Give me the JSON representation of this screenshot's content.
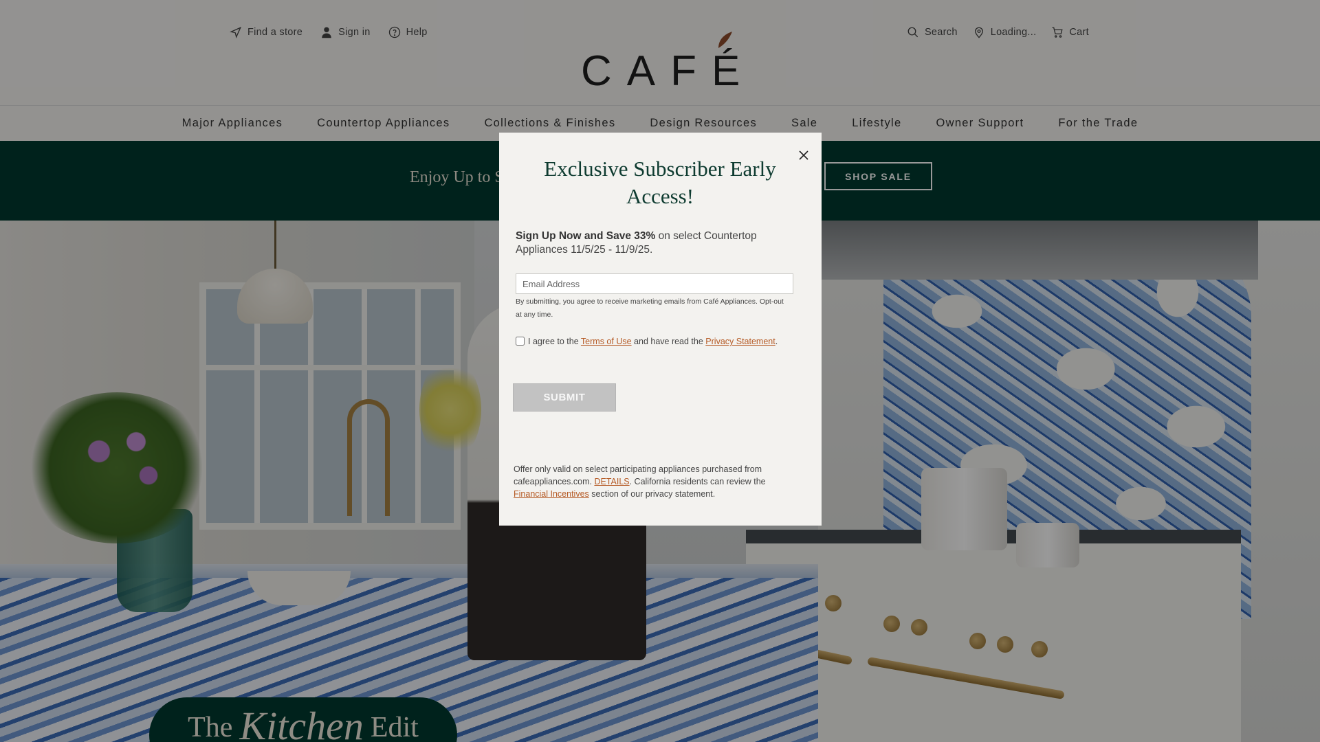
{
  "header": {
    "util_left": [
      {
        "label": "Find a store",
        "icon": "navigation-arrow-icon"
      },
      {
        "label": "Sign in",
        "icon": "user-icon"
      },
      {
        "label": "Help",
        "icon": "help-circle-icon"
      }
    ],
    "util_right": [
      {
        "label": "Search",
        "icon": "search-icon"
      },
      {
        "label": "Loading...",
        "icon": "location-pin-icon"
      },
      {
        "label": "Cart",
        "icon": "cart-icon"
      }
    ],
    "logo_text": "CAFÉ"
  },
  "nav": {
    "items": [
      "Major Appliances",
      "Countertop Appliances",
      "Collections & Finishes",
      "Design Resources",
      "Sale",
      "Lifestyle",
      "Owner Support",
      "For the Trade"
    ]
  },
  "promo": {
    "text": "Enjoy Up to S",
    "button": "SHOP SALE",
    "bg_color": "#00392f"
  },
  "hero": {
    "badge_the": "The",
    "badge_kitchen": "Kitchen",
    "badge_edit": "Edit"
  },
  "modal": {
    "title": "Exclusive Subscriber Early Access!",
    "lead_bold": "Sign Up Now and Save 33%",
    "lead_rest": " on select Countertop Appliances 11/5/25 - 11/9/25.",
    "email_placeholder": "Email Address",
    "consent": "By submitting, you agree to receive marketing emails from Café Appliances. Opt-out at any time.",
    "agree_prefix": "I agree to the ",
    "terms_link": "Terms of Use",
    "agree_middle": " and have read the ",
    "privacy_link": "Privacy Statement",
    "agree_suffix": ".",
    "submit": "SUBMIT",
    "offer_1": "Offer only valid on select participating appliances purchased from cafeappliances.com. ",
    "details_link": "DETAILS",
    "offer_2": ". California residents can review the ",
    "incentives_link": "Financial Incentives",
    "offer_3": " section of our privacy statement.",
    "accent_color": "#0e3b30",
    "link_color": "#b55a25"
  }
}
